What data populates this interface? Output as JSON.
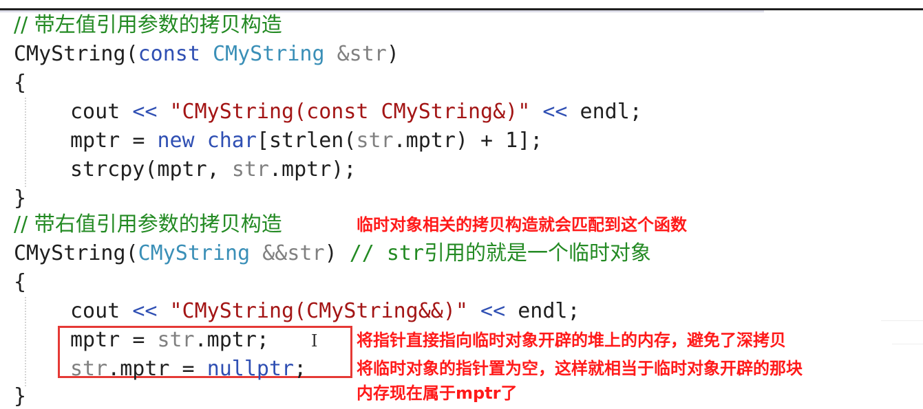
{
  "code": {
    "comment1": "// 带左值引用参数的拷贝构造",
    "ctor1": {
      "name": "CMyString",
      "paren_open": "(",
      "kw_const": "const",
      "type": "CMyString",
      "param": "&str",
      "paren_close": ")"
    },
    "brace_open_1": "{",
    "cout1": {
      "cout": "cout",
      "op1": "<<",
      "str": "\"CMyString(const CMyString&)\"",
      "op2": "<<",
      "endl": "endl;"
    },
    "alloc": {
      "lhs": "mptr",
      "eq": "=",
      "kw_new": "new",
      "kw_char": "char",
      "rest1": "[strlen(",
      "str": "str",
      "rest2": ".mptr) + 1];"
    },
    "strcpy": {
      "fn": "strcpy(mptr, ",
      "str": "str",
      "rest": ".mptr);"
    },
    "brace_close_1": "}",
    "comment2": "// 带右值引用参数的拷贝构造",
    "ctor2": {
      "name": "CMyString",
      "paren_open": "(",
      "type": "CMyString",
      "param": "&&str",
      "paren_close": ")",
      "comment_slashes": "//",
      "comment_str": "str",
      "comment_cn": "引用的就是一个临时对象"
    },
    "brace_open_2": "{",
    "cout2": {
      "cout": "cout",
      "op1": "<<",
      "str": "\"CMyString(CMyString&&)\"",
      "op2": "<<",
      "endl": "endl;"
    },
    "move_assign": {
      "lhs": "mptr",
      "eq": "=",
      "str": "str",
      "rest": ".mptr;"
    },
    "null_assign": {
      "str": "str",
      "rest": ".mptr =",
      "kw_nullptr": "nullptr",
      "semi": ";"
    },
    "brace_close_2": "}"
  },
  "annotations": {
    "note_rvalue_ctor": "临时对象相关的拷贝构造就会匹配到这个函数",
    "note_move_ptr": "将指针直接指向临时对象开辟的堆上的内存，避免了深拷贝",
    "note_null_line1": "将临时对象的指针置为空，这样就相当于临时对象开辟的那块",
    "note_null_line2": "内存现在属于mptr了"
  },
  "cursor_glyph": "I",
  "colors": {
    "keyword": "#2f4fb3",
    "type": "#3a8fb7",
    "string": "#a31515",
    "comment": "#238a23",
    "param": "#808080",
    "annotation": "#ff1a1a",
    "highlight_box": "#e53935"
  }
}
